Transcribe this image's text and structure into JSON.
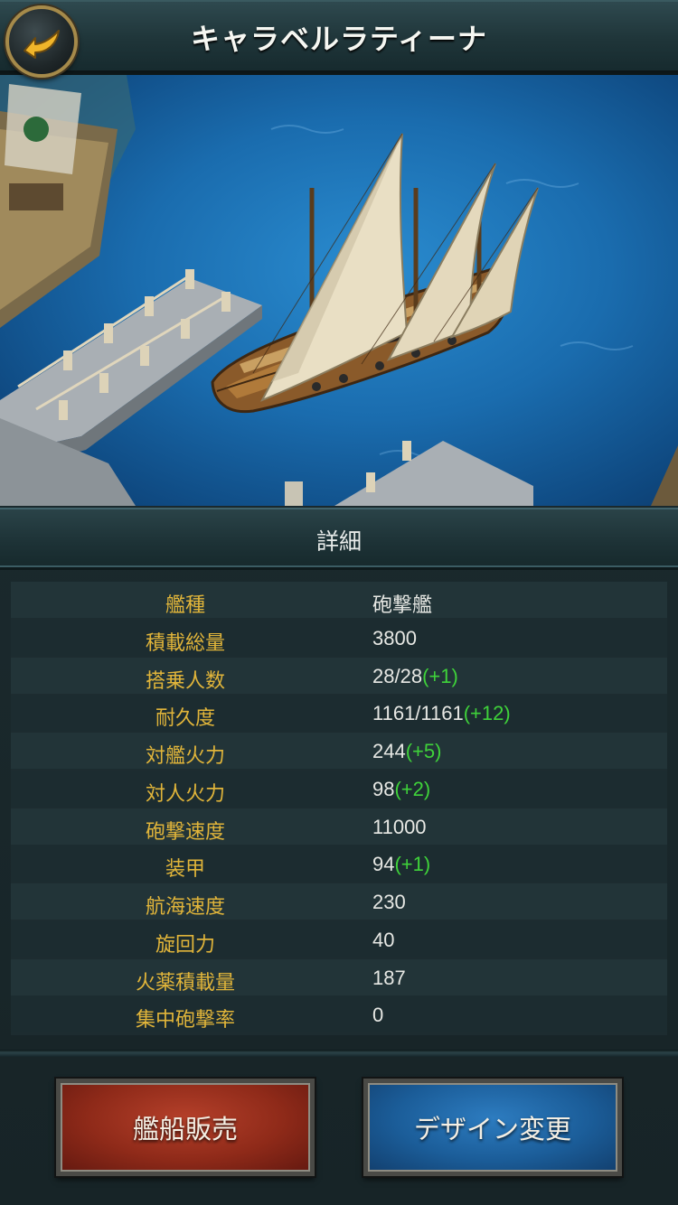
{
  "header": {
    "title": "キャラベルラティーナ",
    "back_icon": "back-arrow-icon"
  },
  "scene": {
    "description_icon": "caravel-ship-illustration"
  },
  "section": {
    "title": "詳細"
  },
  "stats": [
    {
      "label": "艦種",
      "value": "砲撃艦",
      "bonus": ""
    },
    {
      "label": "積載総量",
      "value": "3800",
      "bonus": ""
    },
    {
      "label": "搭乗人数",
      "value": "28/28",
      "bonus": "(+1)"
    },
    {
      "label": "耐久度",
      "value": "1161/1161",
      "bonus": "(+12)"
    },
    {
      "label": "対艦火力",
      "value": "244",
      "bonus": "(+5)"
    },
    {
      "label": "対人火力",
      "value": "98",
      "bonus": "(+2)"
    },
    {
      "label": "砲撃速度",
      "value": "11000",
      "bonus": ""
    },
    {
      "label": "装甲",
      "value": "94",
      "bonus": "(+1)"
    },
    {
      "label": "航海速度",
      "value": "230",
      "bonus": ""
    },
    {
      "label": "旋回力",
      "value": "40",
      "bonus": ""
    },
    {
      "label": "火薬積載量",
      "value": "187",
      "bonus": ""
    },
    {
      "label": "集中砲撃率",
      "value": "0",
      "bonus": ""
    }
  ],
  "buttons": {
    "sell_label": "艦船販売",
    "design_label": "デザイン変更"
  },
  "colors": {
    "label_gold": "#e1b53a",
    "bonus_green": "#3fd23a",
    "sell_red": "#8f2a19",
    "design_blue": "#1b5d99"
  }
}
